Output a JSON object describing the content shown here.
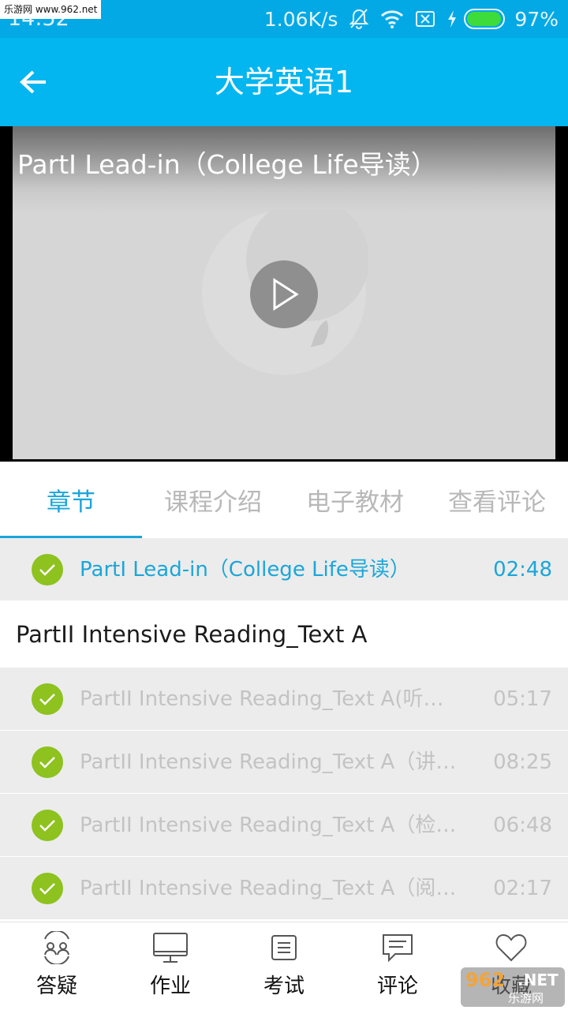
{
  "status_bar": {
    "time": "14:52",
    "network_speed": "1.06K/s",
    "battery_percent": "97%",
    "battery_level": 0.97,
    "icons": [
      "mute-bell-icon",
      "wifi-icon",
      "no-sim-icon",
      "charging-icon",
      "battery-icon"
    ]
  },
  "watermark": {
    "top_text": "乐游网 www.962.net",
    "corner_main": "962",
    "corner_net": ".NET",
    "corner_sub": "乐游网"
  },
  "header": {
    "title": "大学英语1",
    "back_icon": "arrow-left-icon"
  },
  "video": {
    "title": "PartI Lead-in（College Life导读）",
    "play_icon": "play-icon"
  },
  "tabs": [
    {
      "label": "章节",
      "active": true
    },
    {
      "label": "课程介绍",
      "active": false
    },
    {
      "label": "电子教材",
      "active": false
    },
    {
      "label": "查看评论",
      "active": false
    }
  ],
  "chapters": {
    "current": {
      "title": "PartI Lead-in（College Life导读）",
      "duration": "02:48",
      "completed": true
    },
    "section_title": "PartII Intensive Reading_Text A",
    "items": [
      {
        "title": "PartII Intensive Reading_Text A(听音…",
        "duration": "05:17",
        "completed": true
      },
      {
        "title": "PartII Intensive Reading_Text A（讲…",
        "duration": "08:25",
        "completed": true
      },
      {
        "title": "PartII Intensive Reading_Text A（检…",
        "duration": "06:48",
        "completed": true
      },
      {
        "title": "PartII Intensive Reading_Text A（阅…",
        "duration": "02:17",
        "completed": true
      }
    ]
  },
  "bottom_nav": [
    {
      "label": "答疑",
      "icon": "qa-users-icon"
    },
    {
      "label": "作业",
      "icon": "monitor-icon"
    },
    {
      "label": "考试",
      "icon": "exam-document-icon"
    },
    {
      "label": "评论",
      "icon": "comment-icon"
    },
    {
      "label": "收藏",
      "icon": "heart-icon"
    }
  ],
  "colors": {
    "status_bar": "#03a9e5",
    "app_bar": "#03b6ef",
    "accent": "#1aa6d9",
    "check_green": "#8dc21f",
    "row_bg": "#ececec"
  }
}
